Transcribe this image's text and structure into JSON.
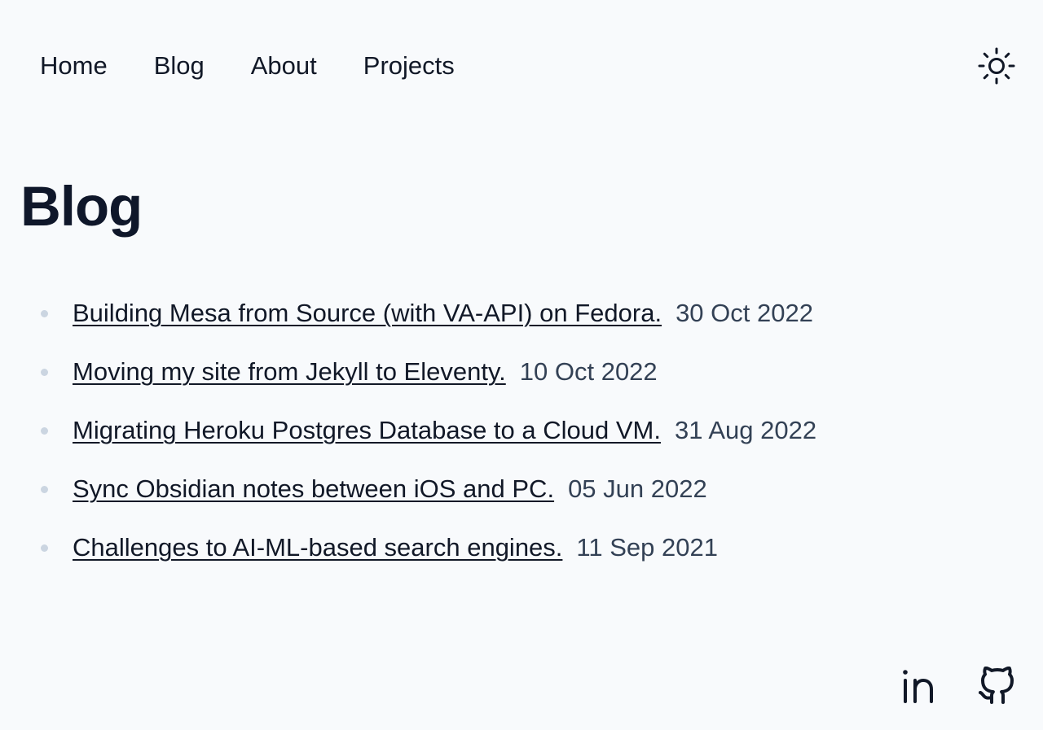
{
  "nav": {
    "items": [
      {
        "label": "Home"
      },
      {
        "label": "Blog"
      },
      {
        "label": "About"
      },
      {
        "label": "Projects"
      }
    ]
  },
  "theme_toggle": {
    "icon": "sun-icon"
  },
  "page": {
    "title": "Blog"
  },
  "posts": [
    {
      "title": "Building Mesa from Source (with VA-API) on Fedora.",
      "date": "30 Oct 2022"
    },
    {
      "title": "Moving my site from Jekyll to Eleventy.",
      "date": "10 Oct 2022"
    },
    {
      "title": "Migrating Heroku Postgres Database to a Cloud VM.",
      "date": "31 Aug 2022"
    },
    {
      "title": "Sync Obsidian notes between iOS and PC.",
      "date": "05 Jun 2022"
    },
    {
      "title": "Challenges to AI-ML-based search engines.",
      "date": "11 Sep 2021"
    }
  ],
  "footer": {
    "icons": [
      "linkedin-icon",
      "github-icon"
    ]
  },
  "colors": {
    "background": "#f8fafc",
    "text": "#111827",
    "date": "#334155",
    "bullet": "#cbd5e1"
  }
}
